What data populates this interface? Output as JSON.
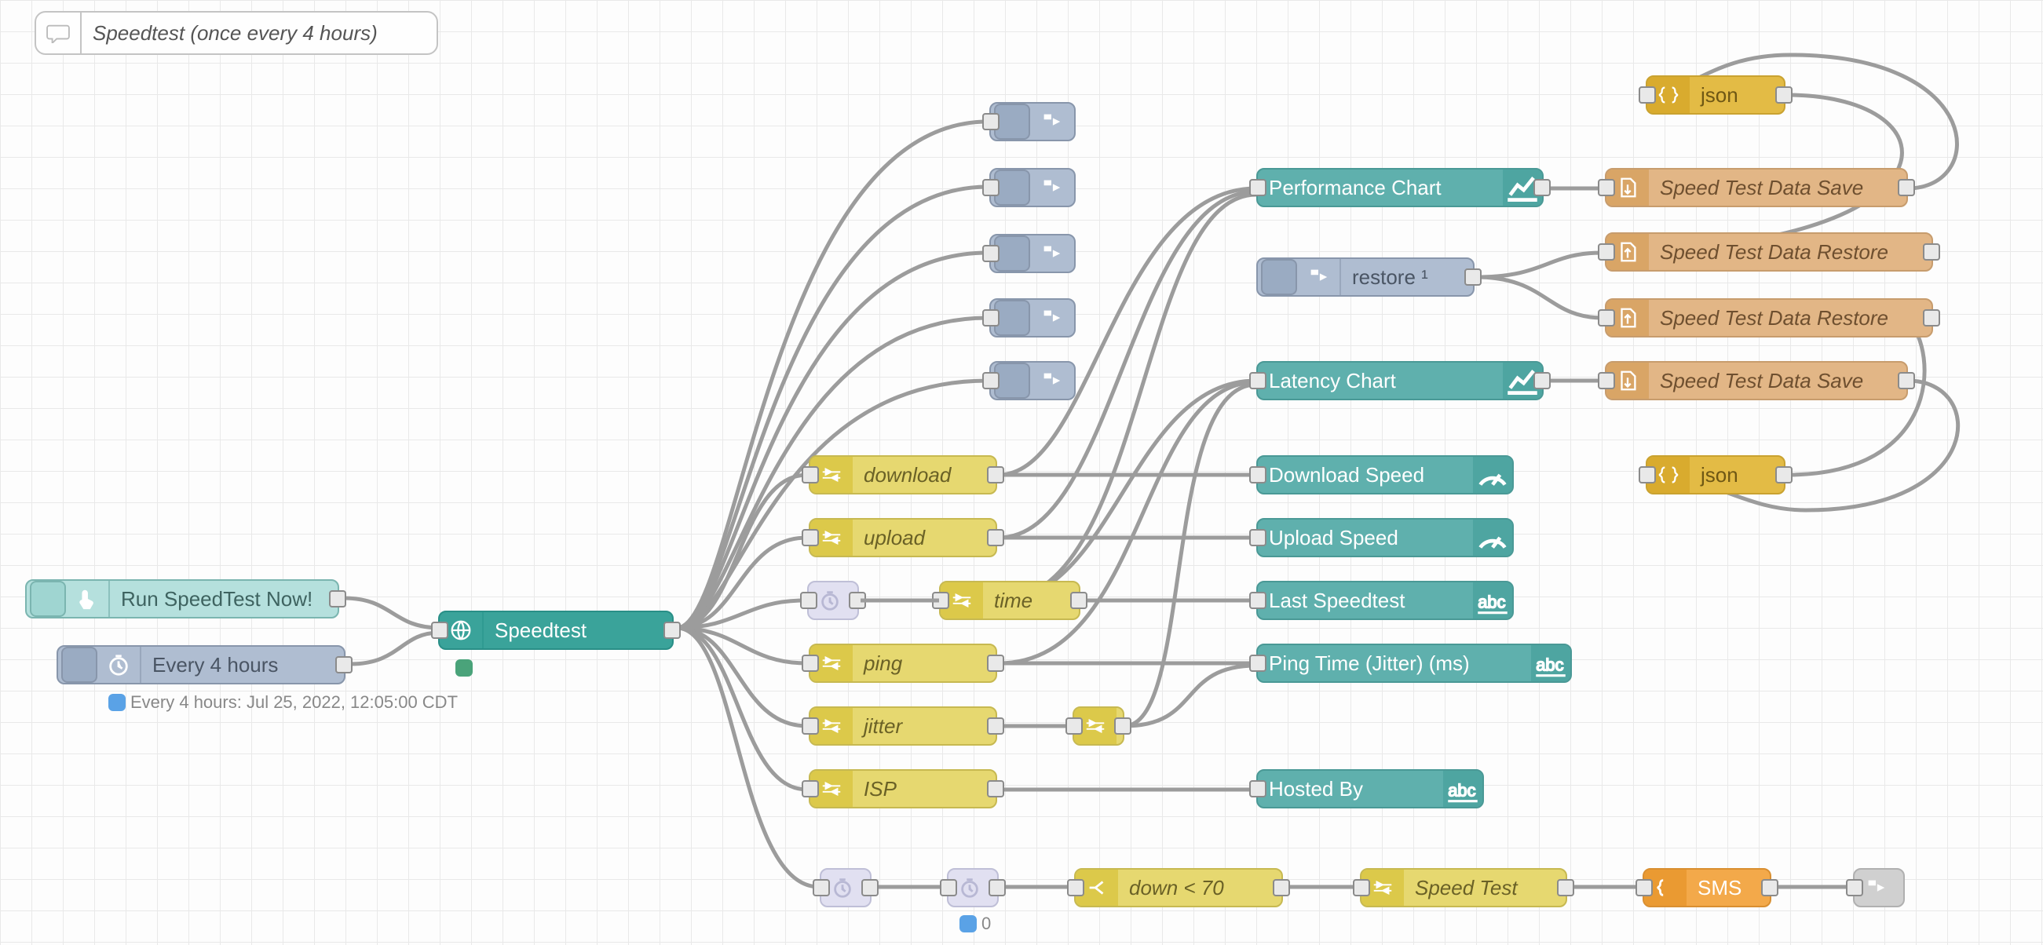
{
  "comment": {
    "text": "Speedtest (once every 4 hours)"
  },
  "triggers": {
    "run_now": "Run SpeedTest Now!",
    "every4": "Every 4 hours",
    "every4_status": "Every 4 hours: Jul 25, 2022, 12:05:00 CDT"
  },
  "speedtest": {
    "label": "Speedtest"
  },
  "changes": {
    "download": "download",
    "upload": "upload",
    "time": "time",
    "ping": "ping",
    "jitter": "jitter",
    "isp": "ISP"
  },
  "link_restore": "restore ¹",
  "charts": {
    "perf": "Performance Chart",
    "latency": "Latency Chart"
  },
  "gauges": {
    "download": "Download Speed",
    "upload": "Upload Speed",
    "last": "Last Speedtest",
    "ping": "Ping Time (Jitter) (ms)",
    "hosted": "Hosted By"
  },
  "files": {
    "save1": "Speed Test Data Save",
    "restore1": "Speed Test Data Restore",
    "restore2": "Speed Test Data Restore",
    "save2": "Speed Test Data Save"
  },
  "json_nodes": {
    "a": "json",
    "b": "json"
  },
  "bottom": {
    "down70": "down < 70",
    "speedtest": "Speed Test",
    "sms": "SMS",
    "delay_count": "0"
  }
}
